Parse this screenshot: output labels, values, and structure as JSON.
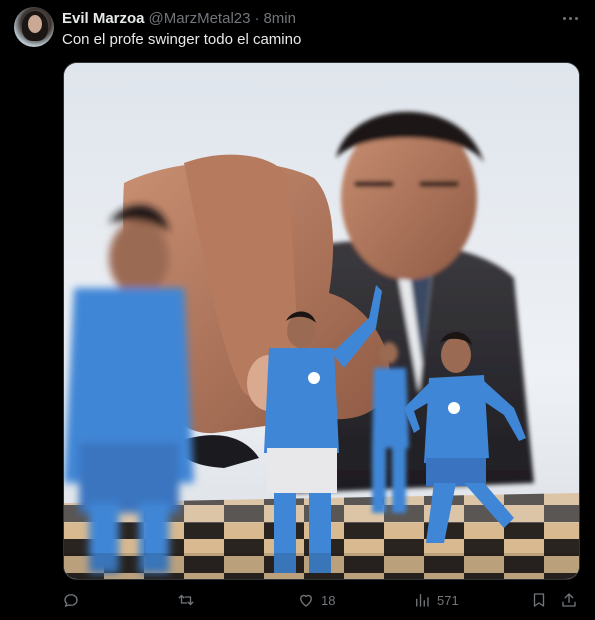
{
  "tweet": {
    "author_name": "Evil Marzoa",
    "author_handle": "@MarzMetal23",
    "separator": "·",
    "time": "8min",
    "text": "Con el profe swinger todo el camino",
    "likes": "18",
    "views": "571"
  },
  "icons": {
    "more": "more-horizontal-icon",
    "reply": "reply-icon",
    "retweet": "retweet-icon",
    "like": "heart-icon",
    "views": "views-icon",
    "bookmark": "bookmark-icon",
    "share": "share-icon"
  },
  "colors": {
    "background": "#000000",
    "text": "#e7e9ea",
    "muted": "#71767b",
    "jersey_blue": "#3f86d6"
  }
}
